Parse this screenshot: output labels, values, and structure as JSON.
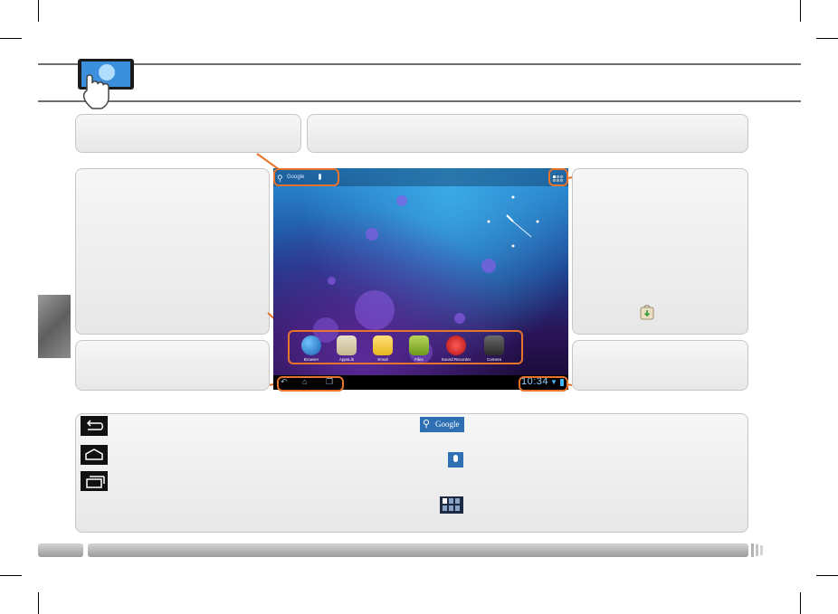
{
  "page": {
    "status_time": "10:34",
    "search_text": "Google",
    "apps": [
      "Browser",
      "AppsLib",
      "Email",
      "Files",
      "Sound Recorder",
      "Camera"
    ]
  },
  "legend": {
    "search_icon_text": "Google"
  },
  "colors": {
    "callout": "#e8732a",
    "panel": "#eeeeee",
    "rule": "#6e6e6e"
  }
}
